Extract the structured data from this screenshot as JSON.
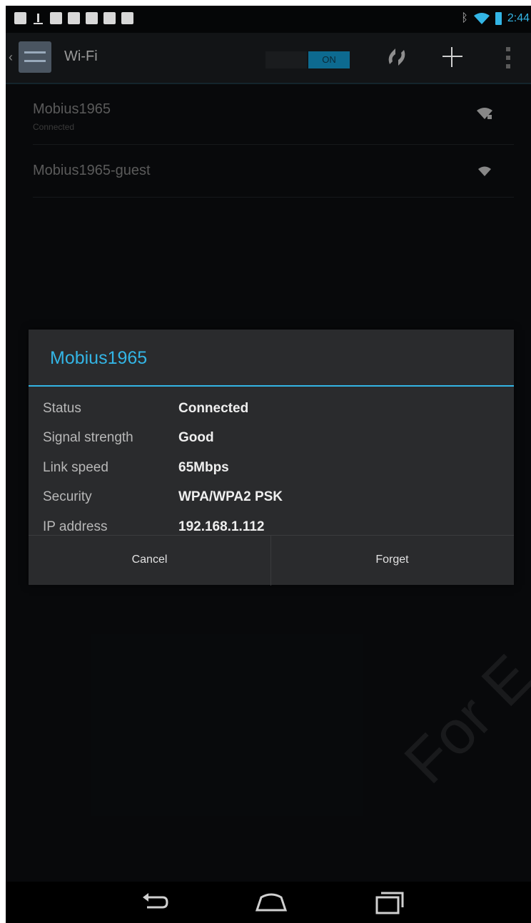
{
  "status_bar": {
    "time": "2:44",
    "bluetooth_glyph": "ᛒ",
    "left_icons": [
      "gallery-icon",
      "upload-icon",
      "gmail-icon",
      "calendar-icon",
      "dropbox-icon",
      "checkbox-icon",
      "briefcase-icon"
    ],
    "right_icons": [
      "bluetooth-icon",
      "wifi-icon",
      "battery-icon"
    ],
    "accent_color": "#33b5e5"
  },
  "action_bar": {
    "title": "Wi-Fi",
    "toggle_label": "ON",
    "actions": [
      "wps-icon",
      "add-network-icon",
      "overflow-menu-icon"
    ]
  },
  "networks": [
    {
      "name": "Mobius1965",
      "status": "Connected",
      "signal": "secured-strong"
    },
    {
      "name": "Mobius1965-guest",
      "status": "",
      "signal": "medium"
    }
  ],
  "dialog": {
    "title": "Mobius1965",
    "rows": [
      {
        "label": "Status",
        "value": "Connected"
      },
      {
        "label": "Signal strength",
        "value": "Good"
      },
      {
        "label": "Link speed",
        "value": "65Mbps"
      },
      {
        "label": "Security",
        "value": "WPA/WPA2 PSK"
      },
      {
        "label": "IP address",
        "value": "192.168.1.112"
      }
    ],
    "cancel_label": "Cancel",
    "forget_label": "Forget"
  },
  "nav_bar": {
    "buttons": [
      "back-icon",
      "home-icon",
      "recents-icon"
    ]
  },
  "watermark": "For E"
}
